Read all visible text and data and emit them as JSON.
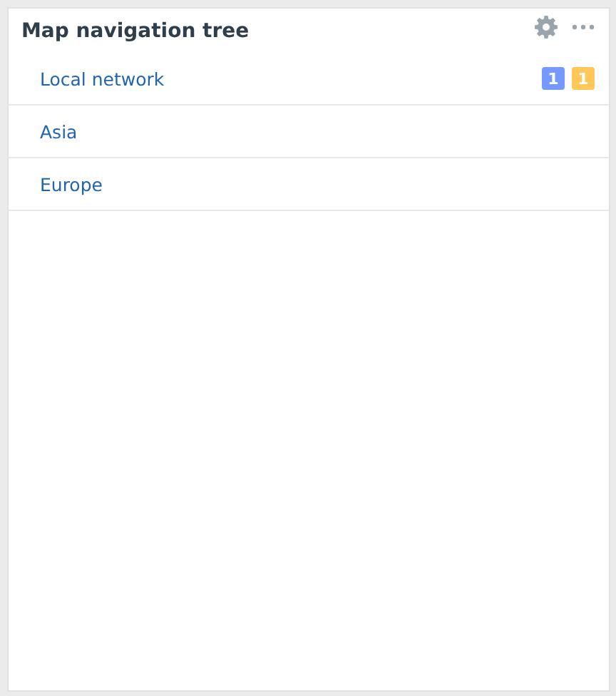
{
  "widget": {
    "title": "Map navigation tree"
  },
  "items": [
    {
      "label": "Local network",
      "badges": [
        {
          "text": "1",
          "color": "#7499ff"
        },
        {
          "text": "1",
          "color": "#ffc859"
        }
      ]
    },
    {
      "label": "Asia"
    },
    {
      "label": "Europe"
    }
  ]
}
